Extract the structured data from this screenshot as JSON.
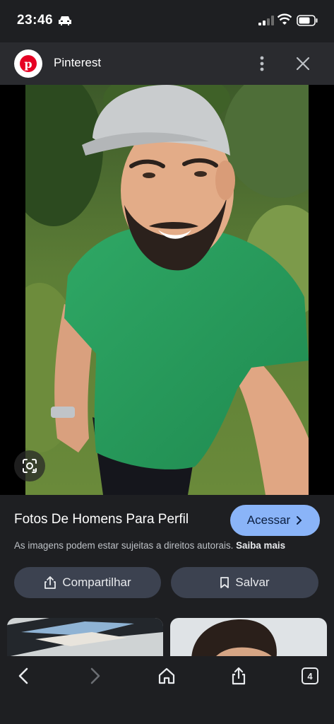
{
  "status_bar": {
    "time": "23:46"
  },
  "header": {
    "site_name": "Pinterest",
    "logo_letter": "p"
  },
  "result": {
    "title": "Fotos De Homens Para Perfil",
    "visit_label": "Acessar",
    "copyright_text": "As imagens podem estar sujeitas a direitos autorais.",
    "learn_more_label": "Saiba mais",
    "share_label": "Compartilhar",
    "save_label": "Salvar"
  },
  "toolbar": {
    "tab_count": "4"
  },
  "colors": {
    "background": "#1e1f22",
    "header": "#2a2b2f",
    "accent_button": "#8ab4f8",
    "secondary_button": "#3c4250",
    "pinterest_red": "#e60023"
  },
  "icons": [
    "car-icon",
    "signal-icon",
    "wifi-icon",
    "battery-icon",
    "more-vertical-icon",
    "close-icon",
    "lens-icon",
    "chevron-right-icon",
    "share-icon",
    "bookmark-icon",
    "back-arrow-icon",
    "forward-arrow-icon",
    "home-icon",
    "share-page-icon",
    "tabs-icon"
  ]
}
